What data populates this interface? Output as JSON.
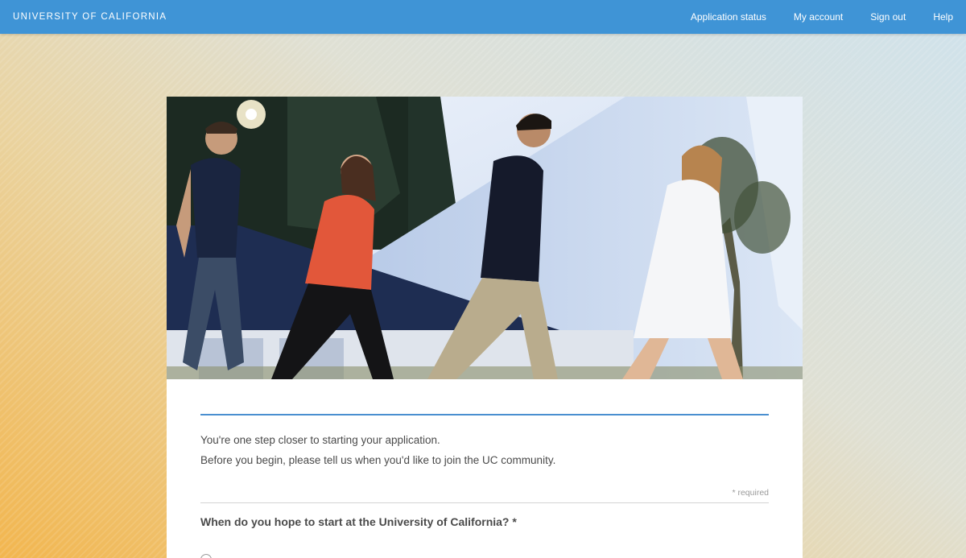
{
  "header": {
    "brand": "UNIVERSITY OF CALIFORNIA",
    "nav": [
      {
        "label": "Application status"
      },
      {
        "label": "My account"
      },
      {
        "label": "Sign out"
      },
      {
        "label": "Help"
      }
    ]
  },
  "colors": {
    "topbar": "#3f94d6",
    "accent_rule": "#4a8fd0",
    "text": "#4a4a4a"
  },
  "intro": {
    "line1": "You're one step closer to starting your application.",
    "line2": "Before you begin, please tell us when you'd like to join the UC community."
  },
  "form": {
    "required_note": "* required",
    "question": "When do you hope to start at the University of California? *"
  }
}
